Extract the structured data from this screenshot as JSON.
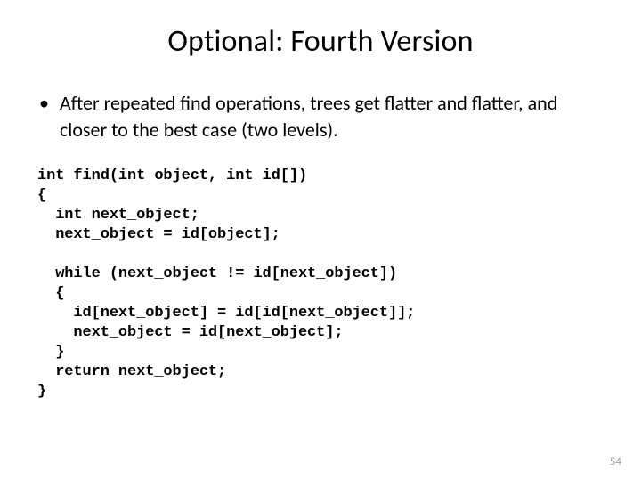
{
  "title": "Optional: Fourth Version",
  "bullet": {
    "text": "After repeated find operations, trees get flatter and flatter, and closer to the best case (two levels)."
  },
  "code": "int find(int object, int id[])\n{\n  int next_object;\n  next_object = id[object];\n\n  while (next_object != id[next_object])\n  {\n    id[next_object] = id[id[next_object]];\n    next_object = id[next_object];\n  }\n  return next_object;\n}",
  "page_number": "54"
}
